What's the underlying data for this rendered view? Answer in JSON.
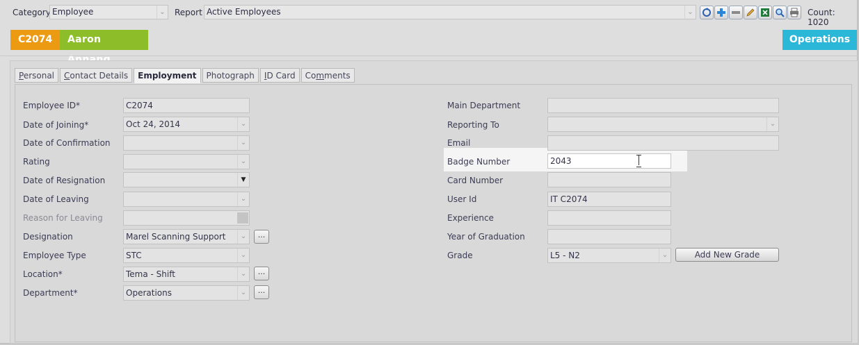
{
  "toolbar": {
    "category_label": "Category",
    "category_value": "Employee",
    "report_label": "Report",
    "report_value": "Active Employees",
    "count_text": "Count: 1020"
  },
  "header": {
    "employee_code": "C2074",
    "employee_name": "Aaron  Annang",
    "department": "Operations"
  },
  "tabs": [
    {
      "label": "Personal",
      "u": "P",
      "rest": "ersonal"
    },
    {
      "label": "Contact Details",
      "u": "C",
      "rest": "ontact Details"
    },
    {
      "label": "Employment"
    },
    {
      "label": "Photograph"
    },
    {
      "label": "ID Card",
      "u": "I",
      "rest": "D Card"
    },
    {
      "label": "Comments",
      "pre": "Co",
      "u": "m",
      "rest": "ments"
    }
  ],
  "left": {
    "employee_id": {
      "label": "Employee ID*",
      "value": "C2074"
    },
    "date_joining": {
      "label": "Date of Joining*",
      "value": "Oct 24, 2014"
    },
    "date_confirmation": {
      "label": "Date of Confirmation",
      "value": ""
    },
    "rating": {
      "label": "Rating",
      "value": ""
    },
    "date_resignation": {
      "label": "Date of Resignation",
      "value": ""
    },
    "date_leaving": {
      "label": "Date of Leaving",
      "value": ""
    },
    "reason_leaving": {
      "label": "Reason for Leaving",
      "value": ""
    },
    "designation": {
      "label": "Designation",
      "value": "Marel Scanning Support"
    },
    "employee_type": {
      "label": "Employee Type",
      "value": "STC"
    },
    "location": {
      "label": "Location*",
      "value": "Tema - Shift"
    },
    "department": {
      "label": "Department*",
      "value": "Operations"
    },
    "dots": "..."
  },
  "right": {
    "main_department": {
      "label": "Main Department",
      "value": ""
    },
    "reporting_to": {
      "label": "Reporting To",
      "value": ""
    },
    "email": {
      "label": "Email",
      "value": ""
    },
    "badge_number": {
      "label": "Badge Number",
      "value": "2043"
    },
    "card_number": {
      "label": "Card Number",
      "value": ""
    },
    "user_id": {
      "label": "User Id",
      "value": "IT C2074"
    },
    "experience": {
      "label": "Experience",
      "value": ""
    },
    "year_graduation": {
      "label": "Year of Graduation",
      "value": ""
    },
    "grade": {
      "label": "Grade",
      "value": "L5 - N2"
    },
    "add_grade_label": "Add New Grade"
  },
  "icons": [
    "refresh-icon",
    "add-icon",
    "remove-icon",
    "edit-icon",
    "excel-icon",
    "search-icon",
    "print-icon"
  ],
  "colors": {
    "id_badge": "#ec9a12",
    "name_badge": "#8dbe2a",
    "dept_badge": "#2bb7d8"
  }
}
